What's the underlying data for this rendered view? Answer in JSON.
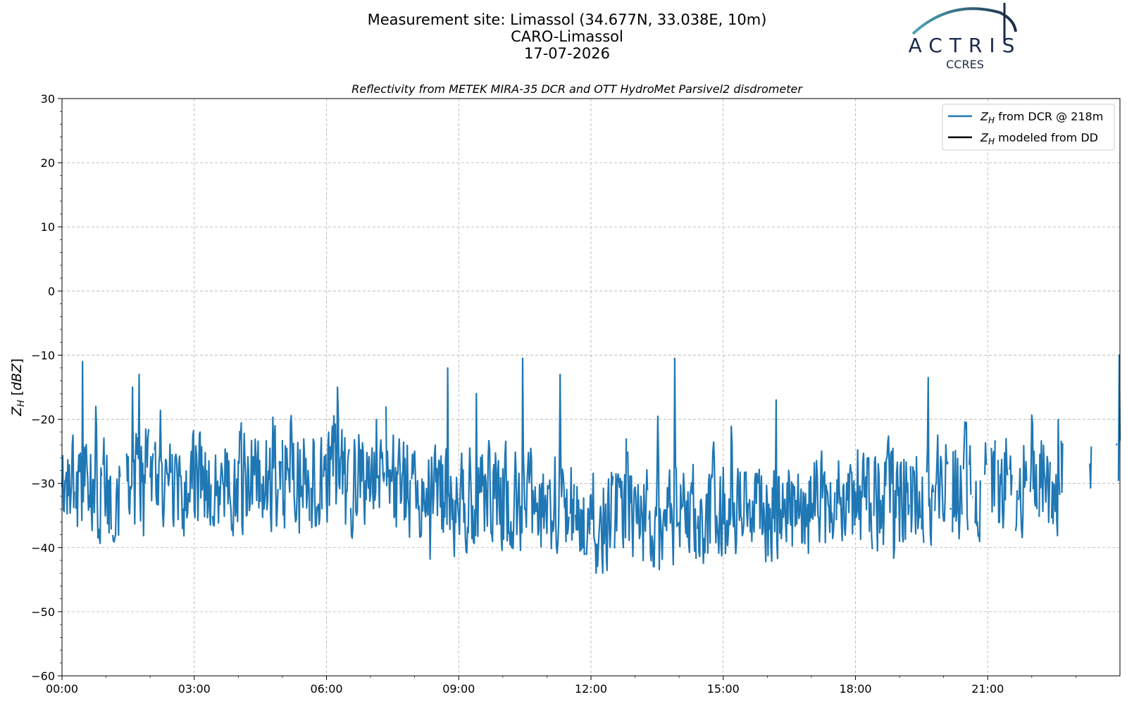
{
  "header": {
    "site_line": "Measurement site: Limassol (34.677N, 33.038E, 10m)",
    "station": "CARO-Limassol",
    "date": "17-07-2026"
  },
  "logo": {
    "name": "ACTRIS",
    "sub": "CCRES",
    "colors": {
      "arc_start": "#4fa9b3",
      "arc_end": "#1b2a4a",
      "text": "#1b2a4a"
    }
  },
  "colors": {
    "dcr": "#1f77b4",
    "dd": "#000000",
    "grid": "#b0b0b0"
  },
  "chart_data": {
    "type": "line",
    "title": "Reflectivity from METEK MIRA-35 DCR and OTT HydroMet Parsivel2 disdrometer",
    "ylabel": "Z_H [dBZ]",
    "xlim": [
      0,
      24
    ],
    "ylim": [
      -60,
      30
    ],
    "yticks": [
      30,
      20,
      10,
      0,
      -10,
      -20,
      -30,
      -40,
      -50,
      -60
    ],
    "ytick_labels": [
      "30",
      "20",
      "10",
      "0",
      "−10",
      "−20",
      "−30",
      "−40",
      "−50",
      "−60"
    ],
    "xticks": [
      0,
      3,
      6,
      9,
      12,
      15,
      18,
      21
    ],
    "xtick_labels": [
      "00:00",
      "03:00",
      "06:00",
      "09:00",
      "12:00",
      "15:00",
      "18:00",
      "21:00"
    ],
    "grid": true,
    "legend_position": "top-right",
    "series": [
      {
        "name": "Z_H from DCR @ 218m",
        "label_main": "Z",
        "label_sub": "H",
        "label_rest": " from DCR @ 218m",
        "color": "#1f77b4",
        "sampling": "approx. 1-minute samples with data gaps",
        "x_range": [
          0,
          24
        ],
        "y_range": [
          -44,
          -10
        ],
        "peaks": [
          {
            "x": 0.47,
            "y": -11
          },
          {
            "x": 1.6,
            "y": -15
          },
          {
            "x": 1.75,
            "y": -13
          },
          {
            "x": 6.25,
            "y": -15
          },
          {
            "x": 8.75,
            "y": -12
          },
          {
            "x": 9.4,
            "y": -16
          },
          {
            "x": 10.45,
            "y": -10.5
          },
          {
            "x": 11.3,
            "y": -13
          },
          {
            "x": 13.9,
            "y": -10.5
          },
          {
            "x": 16.2,
            "y": -17
          },
          {
            "x": 19.65,
            "y": -13.5
          },
          {
            "x": 23.98,
            "y": -10
          }
        ],
        "gaps": [
          [
            1.33,
            1.45
          ],
          [
            22.7,
            23.3
          ],
          [
            23.35,
            23.9
          ]
        ]
      },
      {
        "name": "Z_H modeled from DD",
        "label_main": "Z",
        "label_sub": "H",
        "label_rest": " modeled from DD",
        "color": "#000000",
        "x": [],
        "y": []
      }
    ]
  }
}
